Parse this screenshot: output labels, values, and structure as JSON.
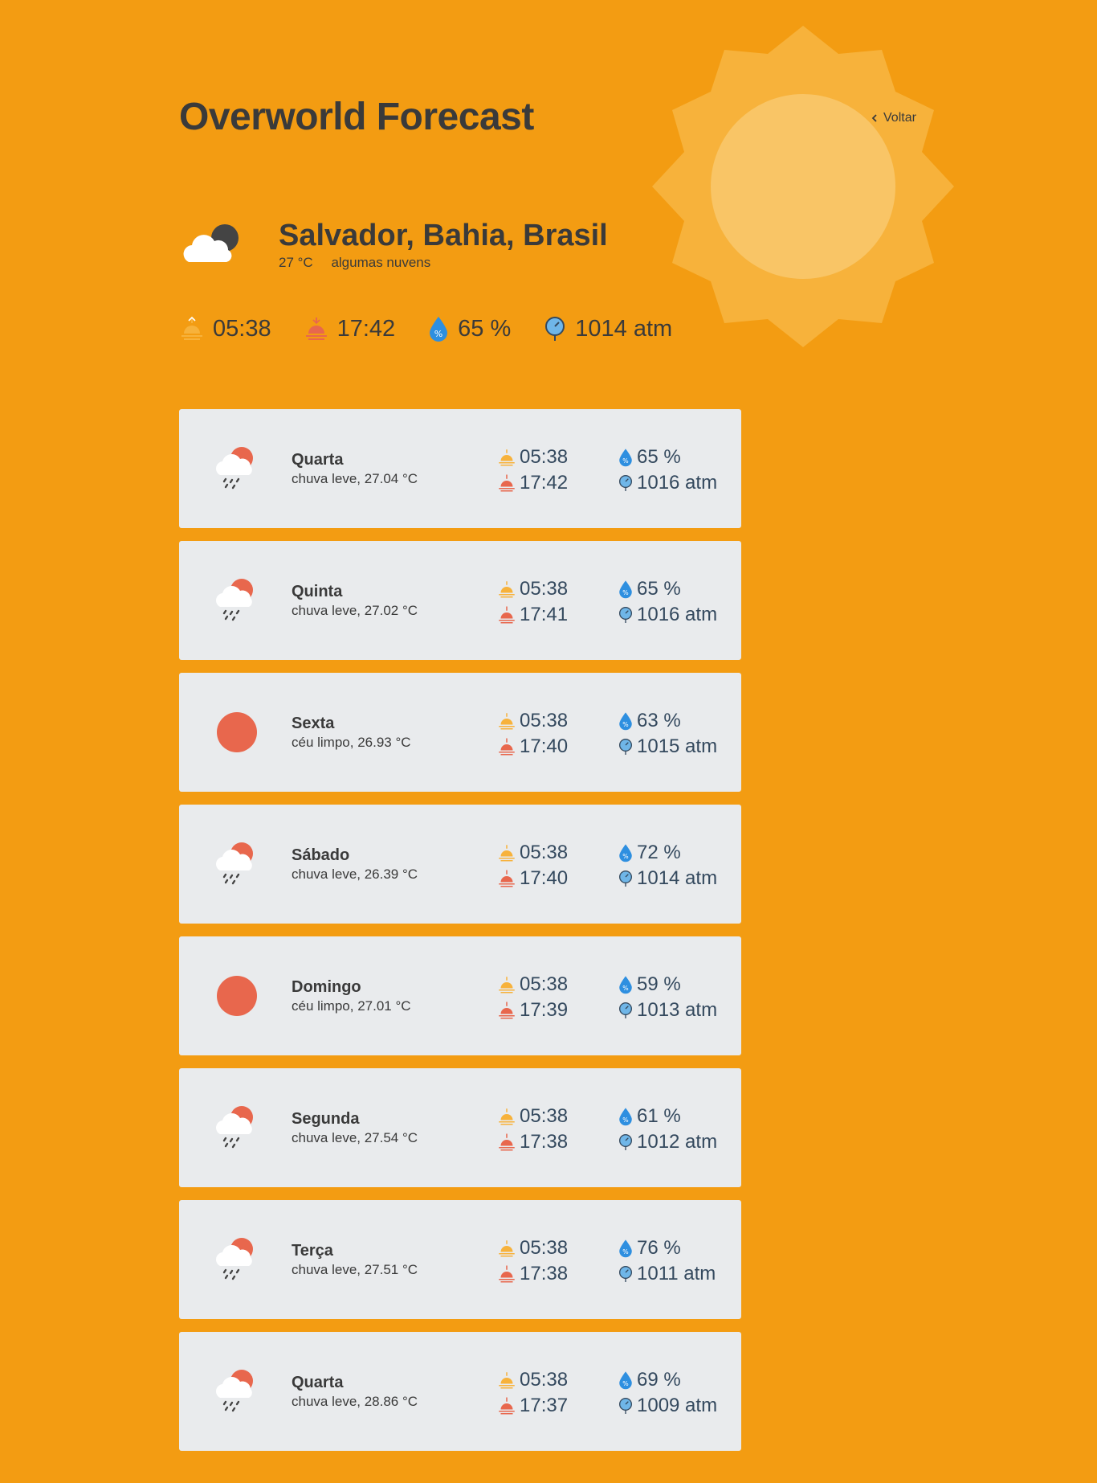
{
  "header": {
    "title": "Overworld Forecast",
    "back_label": "Voltar"
  },
  "current": {
    "city": "Salvador, Bahia, Brasil",
    "temp": "27 °C",
    "condition": "algumas nuvens",
    "icon": "cloud-moon-icon",
    "sunrise": "05:38",
    "sunset": "17:42",
    "humidity": "65 %",
    "pressure": "1014 atm"
  },
  "forecast": [
    {
      "day": "Quarta",
      "desc": "chuva leve, 27.04 °C",
      "icon": "rain-cloud-sun-icon",
      "sunrise": "05:38",
      "sunset": "17:42",
      "humidity": "65 %",
      "pressure": "1016 atm"
    },
    {
      "day": "Quinta",
      "desc": "chuva leve, 27.02 °C",
      "icon": "rain-cloud-sun-icon",
      "sunrise": "05:38",
      "sunset": "17:41",
      "humidity": "65 %",
      "pressure": "1016 atm"
    },
    {
      "day": "Sexta",
      "desc": "céu limpo, 26.93 °C",
      "icon": "sun-icon",
      "sunrise": "05:38",
      "sunset": "17:40",
      "humidity": "63 %",
      "pressure": "1015 atm"
    },
    {
      "day": "Sábado",
      "desc": "chuva leve, 26.39 °C",
      "icon": "rain-cloud-sun-icon",
      "sunrise": "05:38",
      "sunset": "17:40",
      "humidity": "72 %",
      "pressure": "1014 atm"
    },
    {
      "day": "Domingo",
      "desc": "céu limpo, 27.01 °C",
      "icon": "sun-icon",
      "sunrise": "05:38",
      "sunset": "17:39",
      "humidity": "59 %",
      "pressure": "1013 atm"
    },
    {
      "day": "Segunda",
      "desc": "chuva leve, 27.54 °C",
      "icon": "rain-cloud-sun-icon",
      "sunrise": "05:38",
      "sunset": "17:38",
      "humidity": "61 %",
      "pressure": "1012 atm"
    },
    {
      "day": "Terça",
      "desc": "chuva leve, 27.51 °C",
      "icon": "rain-cloud-sun-icon",
      "sunrise": "05:38",
      "sunset": "17:38",
      "humidity": "76 %",
      "pressure": "1011 atm"
    },
    {
      "day": "Quarta",
      "desc": "chuva leve, 28.86 °C",
      "icon": "rain-cloud-sun-icon",
      "sunrise": "05:38",
      "sunset": "17:37",
      "humidity": "69 %",
      "pressure": "1009 atm"
    }
  ],
  "colors": {
    "background": "#F39C12",
    "card": "#E9EBED",
    "sun_accent": "#E8674D",
    "drop_blue": "#2E8FE0"
  }
}
